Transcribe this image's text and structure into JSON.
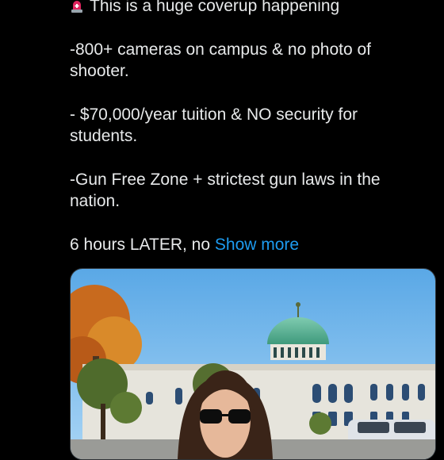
{
  "tweet": {
    "headline": "This is a huge coverup happening",
    "headline_icon": "police-siren-emoji",
    "paragraphs": [
      {
        "line1": "-800+ cameras on campus & no photo of",
        "line2": "shooter."
      },
      {
        "line1": "- $70,000/year tuition & NO security for",
        "line2": "students."
      },
      {
        "line1": "-Gun Free Zone + strictest gun laws in the",
        "line2": "nation."
      }
    ],
    "truncated_text": "6 hours LATER, no",
    "show_more_label": "Show more"
  },
  "colors": {
    "background": "#000000",
    "text": "#e7e9ea",
    "link": "#1d9bf0"
  }
}
